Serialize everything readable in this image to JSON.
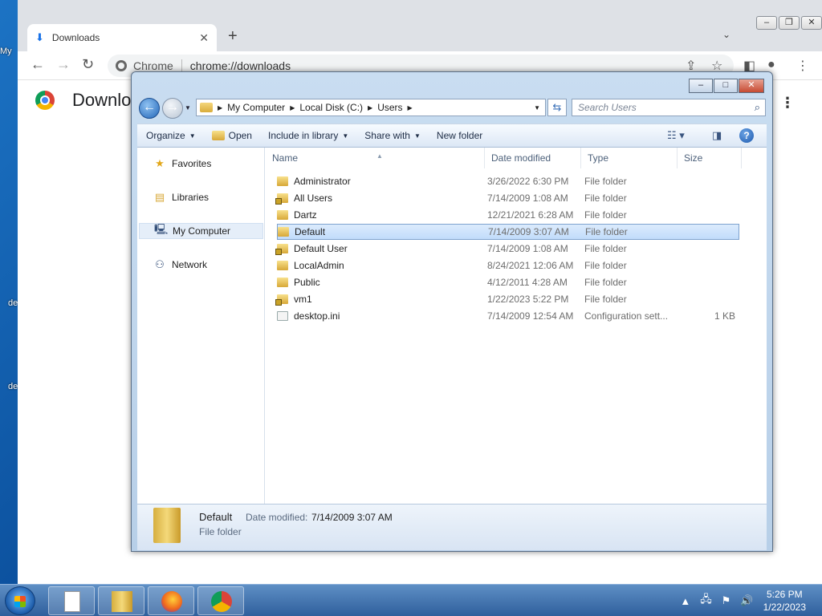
{
  "desktop": {
    "stub_labels": [
      "My",
      "de",
      "de"
    ]
  },
  "chrome": {
    "tab_title": "Downloads",
    "tab_close": "✕",
    "new_tab": "+",
    "tab_menu": "⌄",
    "chip": "Chrome",
    "url": "chrome://downloads",
    "page_title": "Downloads",
    "menu": "⋮",
    "window_controls": [
      "–",
      "❐",
      "✕"
    ]
  },
  "explorer": {
    "window_controls": [
      "–",
      "□",
      "✕"
    ],
    "breadcrumb": [
      "My Computer",
      "Local Disk (C:)",
      "Users"
    ],
    "search_placeholder": "Search Users",
    "commands": {
      "organize": "Organize",
      "open": "Open",
      "include": "Include in library",
      "share": "Share with",
      "new_folder": "New folder"
    },
    "nav": [
      {
        "label": "Favorites",
        "icon": "star-icon"
      },
      {
        "label": "Libraries",
        "icon": "library-icon"
      },
      {
        "label": "My Computer",
        "icon": "computer-icon"
      },
      {
        "label": "Network",
        "icon": "network-icon"
      }
    ],
    "columns": [
      "Name",
      "Date modified",
      "Type",
      "Size"
    ],
    "files": [
      {
        "name": "Administrator",
        "date": "3/26/2022 6:30 PM",
        "type": "File folder",
        "size": ""
      },
      {
        "name": "All Users",
        "date": "7/14/2009 1:08 AM",
        "type": "File folder",
        "size": ""
      },
      {
        "name": "Dartz",
        "date": "12/21/2021 6:28 AM",
        "type": "File folder",
        "size": ""
      },
      {
        "name": "Default",
        "date": "7/14/2009 3:07 AM",
        "type": "File folder",
        "size": ""
      },
      {
        "name": "Default User",
        "date": "7/14/2009 1:08 AM",
        "type": "File folder",
        "size": ""
      },
      {
        "name": "LocalAdmin",
        "date": "8/24/2021 12:06 AM",
        "type": "File folder",
        "size": ""
      },
      {
        "name": "Public",
        "date": "4/12/2011 4:28 AM",
        "type": "File folder",
        "size": ""
      },
      {
        "name": "vm1",
        "date": "1/22/2023 5:22 PM",
        "type": "File folder",
        "size": ""
      },
      {
        "name": "desktop.ini",
        "date": "7/14/2009 12:54 AM",
        "type": "Configuration sett...",
        "size": "1 KB"
      }
    ],
    "details": {
      "name": "Default",
      "modified_label": "Date modified:",
      "modified_value": "7/14/2009 3:07 AM",
      "type": "File folder"
    }
  },
  "taskbar": {
    "time": "5:26 PM",
    "date": "1/22/2023"
  }
}
